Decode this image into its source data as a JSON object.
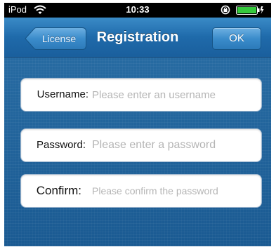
{
  "status_bar": {
    "carrier": "iPod",
    "time": "10:33",
    "wifi_icon": "wifi-icon",
    "lock_icon": "rotation-lock-icon",
    "battery_icon": "battery-icon",
    "battery_color": "#35c93d"
  },
  "nav": {
    "title": "Registration",
    "back_label": "License",
    "ok_label": "OK"
  },
  "form": {
    "username": {
      "label": "Username:",
      "placeholder": "Please enter an username",
      "value": ""
    },
    "password": {
      "label": "Password:",
      "placeholder": "Please enter a password",
      "value": ""
    },
    "confirm": {
      "label": "Confirm:",
      "placeholder": "Please confirm the password",
      "value": ""
    }
  },
  "colors": {
    "background": "#1d5f97",
    "nav_bar": "#2a78b8",
    "placeholder": "#b5b5b5"
  }
}
